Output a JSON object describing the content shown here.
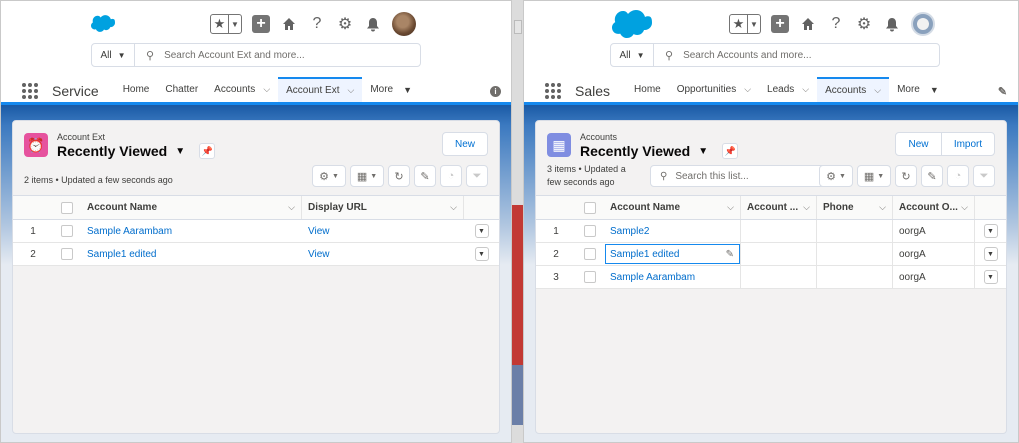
{
  "left": {
    "search_scope": "All",
    "search_placeholder": "Search Account Ext and more...",
    "app_name": "Service",
    "tabs": [
      {
        "label": "Home"
      },
      {
        "label": "Chatter"
      },
      {
        "label": "Accounts"
      },
      {
        "label": "Account Ext"
      },
      {
        "label": "More"
      }
    ],
    "object_label": "Account Ext",
    "list_view": "Recently Viewed",
    "info": "2 items • Updated a few seconds ago",
    "new_label": "New",
    "columns": [
      "Account Name",
      "Display URL"
    ],
    "rows": [
      {
        "num": "1",
        "name": "Sample Aarambam",
        "url": "View"
      },
      {
        "num": "2",
        "name": "Sample1 edited",
        "url": "View"
      }
    ],
    "icon_color": "#e6529e"
  },
  "right": {
    "search_scope": "All",
    "search_placeholder": "Search Accounts and more...",
    "app_name": "Sales",
    "tabs": [
      {
        "label": "Home"
      },
      {
        "label": "Opportunities"
      },
      {
        "label": "Leads"
      },
      {
        "label": "Accounts"
      },
      {
        "label": "More"
      }
    ],
    "object_label": "Accounts",
    "list_view": "Recently Viewed",
    "info_line1": "3 items • Updated a",
    "info_line2": "few seconds ago",
    "new_label": "New",
    "import_label": "Import",
    "list_search_placeholder": "Search this list...",
    "columns": [
      "Account Name",
      "Account ...",
      "Phone",
      "Account O..."
    ],
    "rows": [
      {
        "num": "1",
        "name": "Sample2",
        "site": "",
        "phone": "",
        "owner": "oorgA"
      },
      {
        "num": "2",
        "name": "Sample1 edited",
        "site": "",
        "phone": "",
        "owner": "oorgA"
      },
      {
        "num": "3",
        "name": "Sample Aarambam",
        "site": "",
        "phone": "",
        "owner": "oorgA"
      }
    ],
    "icon_color": "#7f8de1"
  },
  "colors": {
    "brand_blue": "#1589ee",
    "link": "#006dcc",
    "cloud": "#00a1e0"
  }
}
